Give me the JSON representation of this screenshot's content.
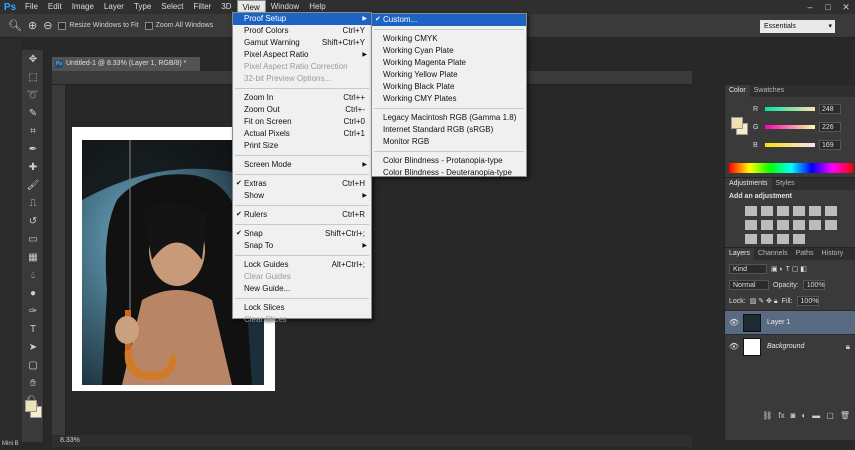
{
  "app": {
    "logo": "Ps"
  },
  "menubar": {
    "items": [
      "File",
      "Edit",
      "Image",
      "Layer",
      "Type",
      "Select",
      "Filter",
      "3D",
      "View",
      "Window",
      "Help"
    ],
    "active": "View",
    "window_controls": [
      "–",
      "□",
      "✕"
    ]
  },
  "options_bar": {
    "resize_windows_label": "Resize Windows to Fit",
    "zoom_all_label": "Zoom All Windows",
    "workspace": "Essentials"
  },
  "document": {
    "tab_title": "Untitled-1 @ 8.33% (Layer 1, RGB/8) *",
    "tab_icon": "Ps",
    "zoom": "8.33%"
  },
  "view_menu": {
    "items": [
      {
        "label": "Proof Setup",
        "shortcut": "",
        "submenu": true,
        "highlight": true
      },
      {
        "label": "Proof Colors",
        "shortcut": "Ctrl+Y"
      },
      {
        "label": "Gamut Warning",
        "shortcut": "Shift+Ctrl+Y"
      },
      {
        "label": "Pixel Aspect Ratio",
        "shortcut": "",
        "submenu": true
      },
      {
        "label": "Pixel Aspect Ratio Correction",
        "shortcut": "",
        "disabled": true
      },
      {
        "label": "32-bit Preview Options...",
        "shortcut": "",
        "disabled": true
      },
      {
        "sep": true
      },
      {
        "label": "Zoom In",
        "shortcut": "Ctrl++"
      },
      {
        "label": "Zoom Out",
        "shortcut": "Ctrl+-"
      },
      {
        "label": "Fit on Screen",
        "shortcut": "Ctrl+0"
      },
      {
        "label": "Actual Pixels",
        "shortcut": "Ctrl+1"
      },
      {
        "label": "Print Size",
        "shortcut": ""
      },
      {
        "sep": true
      },
      {
        "label": "Screen Mode",
        "shortcut": "",
        "submenu": true
      },
      {
        "sep": true
      },
      {
        "label": "Extras",
        "shortcut": "Ctrl+H",
        "checked": true
      },
      {
        "label": "Show",
        "shortcut": "",
        "submenu": true
      },
      {
        "sep": true
      },
      {
        "label": "Rulers",
        "shortcut": "Ctrl+R",
        "checked": true
      },
      {
        "sep": true
      },
      {
        "label": "Snap",
        "shortcut": "Shift+Ctrl+;",
        "checked": true
      },
      {
        "label": "Snap To",
        "shortcut": "",
        "submenu": true
      },
      {
        "sep": true
      },
      {
        "label": "Lock Guides",
        "shortcut": "Alt+Ctrl+;"
      },
      {
        "label": "Clear Guides",
        "shortcut": "",
        "disabled": true
      },
      {
        "label": "New Guide...",
        "shortcut": ""
      },
      {
        "sep": true
      },
      {
        "label": "Lock Slices",
        "shortcut": ""
      },
      {
        "label": "Clear Slices",
        "shortcut": "",
        "disabled": true
      }
    ]
  },
  "proof_submenu": {
    "items": [
      {
        "label": "Custom...",
        "checked": true,
        "highlight": true
      },
      {
        "sep": true
      },
      {
        "label": "Working CMYK"
      },
      {
        "label": "Working Cyan Plate"
      },
      {
        "label": "Working Magenta Plate"
      },
      {
        "label": "Working Yellow Plate"
      },
      {
        "label": "Working Black Plate"
      },
      {
        "label": "Working CMY Plates"
      },
      {
        "sep": true
      },
      {
        "label": "Legacy Macintosh RGB (Gamma 1.8)"
      },
      {
        "label": "Internet Standard RGB (sRGB)"
      },
      {
        "label": "Monitor RGB"
      },
      {
        "sep": true
      },
      {
        "label": "Color Blindness - Protanopia-type"
      },
      {
        "label": "Color Blindness - Deuteranopia-type"
      }
    ]
  },
  "color_panel": {
    "tabs": [
      "Color",
      "Swatches"
    ],
    "r_label": "R",
    "r_value": "248",
    "g_label": "G",
    "g_value": "226",
    "b_label": "B",
    "b_value": "169",
    "fg_color": "#f8e2a9"
  },
  "adjustments_panel": {
    "tabs": [
      "Adjustments",
      "Styles"
    ],
    "title": "Add an adjustment"
  },
  "layers_panel": {
    "tabs": [
      "Layers",
      "Channels",
      "Paths",
      "History"
    ],
    "kind_label": "Kind",
    "blend_mode": "Normal",
    "opacity_label": "Opacity:",
    "opacity_value": "100%",
    "lock_label": "Lock:",
    "fill_label": "Fill:",
    "fill_value": "100%",
    "layers": [
      {
        "name": "Layer 1",
        "selected": true
      },
      {
        "name": "Background",
        "italic": true,
        "locked": true
      }
    ]
  },
  "mini_bridge": "Mini B"
}
